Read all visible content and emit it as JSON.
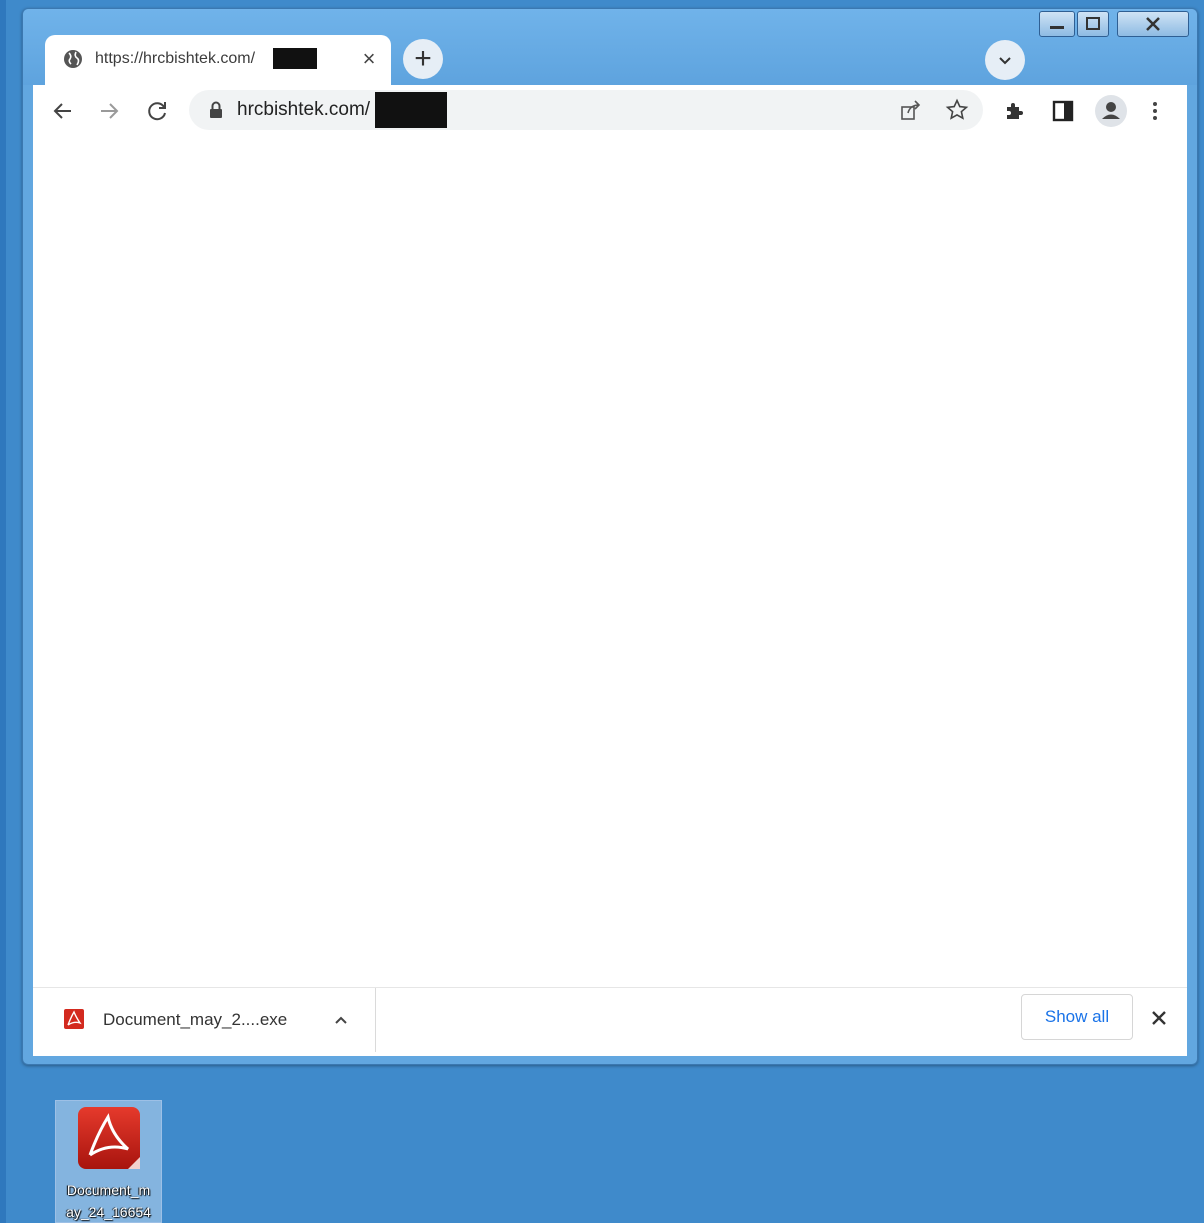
{
  "tab": {
    "title": "https://hrcbishtek.com/",
    "close_glyph": "×"
  },
  "new_tab_glyph": "+",
  "address_bar": {
    "url": "hrcbishtek.com/"
  },
  "download_bar": {
    "file_name": "Document_may_2....exe",
    "show_all_label": "Show all"
  },
  "desktop": {
    "icon_label_line1": "Document_m",
    "icon_label_line2": "ay_24_16654"
  },
  "colors": {
    "accent": "#1a73e8",
    "pdf_red": "#d32a1f",
    "desktop_blue": "#3f8acb"
  }
}
